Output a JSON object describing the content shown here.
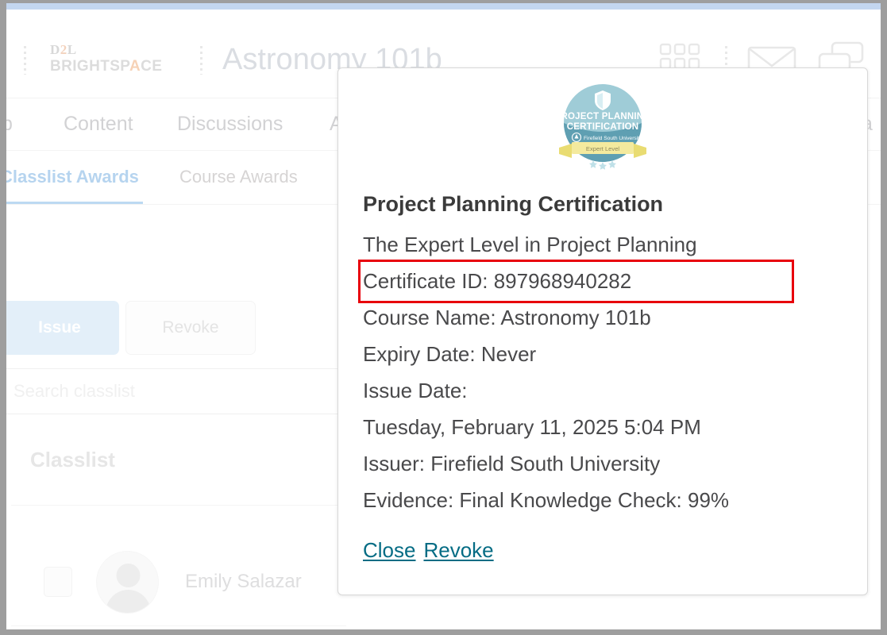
{
  "app": {
    "logo": {
      "line1_pre": "D",
      "line1_mid": "2",
      "line1_post": "L",
      "line2_pre": "BRIGHTSP",
      "line2_mid": "A",
      "line2_post": "CE"
    },
    "course_title": "Astronomy 101b",
    "header_icons": [
      "waffle-grid-icon",
      "envelope-icon",
      "subscriptions-icon"
    ]
  },
  "nav": {
    "items": [
      {
        "label": "p"
      },
      {
        "label": "Content"
      },
      {
        "label": "Discussions"
      },
      {
        "label": "A"
      },
      {
        "label": "a"
      }
    ]
  },
  "subtabs": {
    "items": [
      {
        "label": "Classlist Awards",
        "active": true
      },
      {
        "label": "Course Awards",
        "active": false
      }
    ]
  },
  "toolbar": {
    "issue_label": "Issue",
    "revoke_label": "Revoke"
  },
  "search": {
    "value": "",
    "placeholder": "Search classlist"
  },
  "classlist": {
    "heading": "Classlist",
    "rows": [
      {
        "name": "Emily Salazar"
      }
    ]
  },
  "dialog": {
    "badge": {
      "title_line1": "PROJECT PLANNING",
      "title_line2": "CERTIFICATION",
      "issuer": "Firefield South University",
      "ribbon": "Expert Level",
      "colors": {
        "circle": "#9fccd7",
        "circle_dark": "#5f9fb2",
        "ribbon": "#f4ea9e",
        "ribbon_edge": "#e9dc72"
      }
    },
    "title": "Project Planning Certification",
    "description": "The Expert Level in Project Planning",
    "certificate_id": "Certificate ID:  897968940282",
    "course_name": "Course Name:  Astronomy 101b",
    "expiry_date": "Expiry Date:  Never",
    "issue_date_label": "Issue Date:",
    "issue_date_value": "Tuesday, February 11, 2025 5:04 PM",
    "issuer": "Issuer:  Firefield South University",
    "evidence": "Evidence:  Final Knowledge Check: 99%",
    "close_label": "Close",
    "revoke_label": "Revoke",
    "highlight_color": "#e8000b",
    "link_color": "#046c84"
  }
}
